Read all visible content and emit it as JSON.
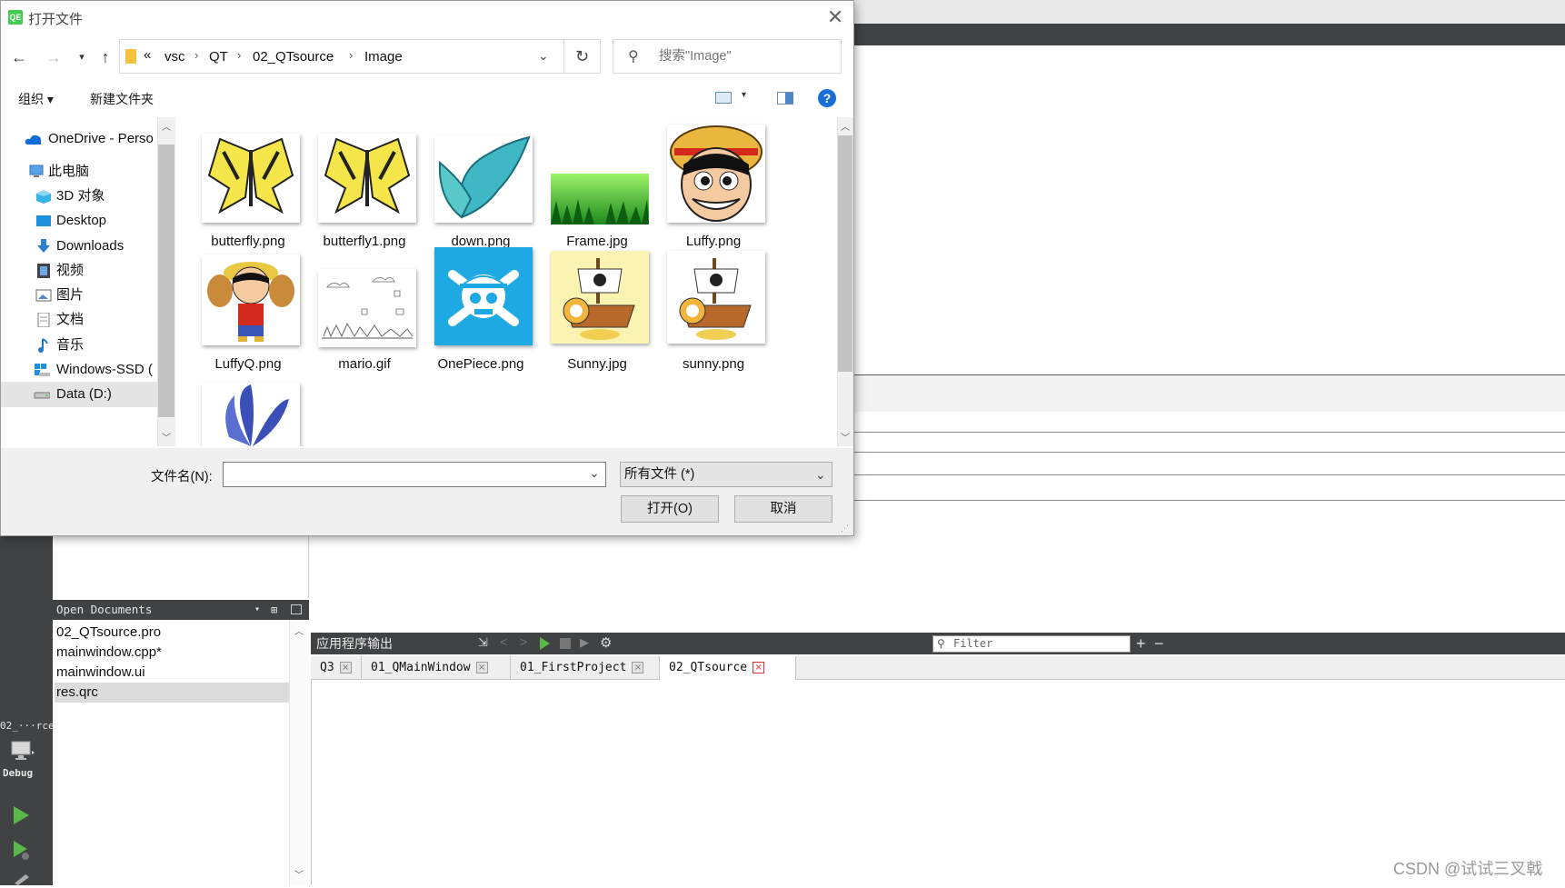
{
  "dialog": {
    "title": "打开文件",
    "app_icon_text": "QE",
    "path_overflow": "«",
    "breadcrumbs": [
      "vsc",
      "QT",
      "02_QTsource",
      "Image"
    ],
    "search_placeholder": "搜索\"Image\"",
    "toolbar": {
      "organize": "组织 ▾",
      "new_folder": "新建文件夹"
    },
    "nav_items": [
      {
        "label": "OneDrive - Perso",
        "icon": "onedrive-cloud-icon"
      },
      {
        "label": "此电脑",
        "icon": "computer-icon"
      },
      {
        "label": "3D 对象",
        "icon": "3d-objects-icon"
      },
      {
        "label": "Desktop",
        "icon": "desktop-icon"
      },
      {
        "label": "Downloads",
        "icon": "download-arrow-icon"
      },
      {
        "label": "视频",
        "icon": "video-film-icon"
      },
      {
        "label": "图片",
        "icon": "pictures-icon"
      },
      {
        "label": "文档",
        "icon": "documents-icon"
      },
      {
        "label": "音乐",
        "icon": "music-note-icon"
      },
      {
        "label": "Windows-SSD (",
        "icon": "windows-drive-icon"
      },
      {
        "label": "Data (D:)",
        "icon": "drive-icon"
      }
    ],
    "files": [
      {
        "name": "butterfly.png",
        "thumb": "yellow-butterfly"
      },
      {
        "name": "butterfly1.png",
        "thumb": "yellow-butterfly"
      },
      {
        "name": "down.png",
        "thumb": "blue-butterfly"
      },
      {
        "name": "Frame.jpg",
        "thumb": "green-forest"
      },
      {
        "name": "Luffy.png",
        "thumb": "luffy-face"
      },
      {
        "name": "LuffyQ.png",
        "thumb": "luffy-chibi"
      },
      {
        "name": "mario.gif",
        "thumb": "mario-sketch"
      },
      {
        "name": "OnePiece.png",
        "thumb": "jolly-roger"
      },
      {
        "name": "Sunny.jpg",
        "thumb": "sunny-ship"
      },
      {
        "name": "sunny.png",
        "thumb": "sunny-ship"
      },
      {
        "name": "",
        "thumb": "purple-butterfly"
      }
    ],
    "filename_label": "文件名(N):",
    "filename_value": "",
    "filetype_selected": "所有文件 (*)",
    "open_button": "打开(O)",
    "cancel_button": "取消"
  },
  "qt": {
    "mode_project_label": "02_···rce",
    "mode_debug_label": "Debug",
    "open_documents_title": "Open Documents",
    "open_documents": [
      "02_QTsource.pro",
      "mainwindow.cpp*",
      "mainwindow.ui",
      "res.qrc"
    ],
    "selected_document": "res.qrc",
    "output_title": "应用程序输出",
    "filter_placeholder": "Filter",
    "output_tabs": [
      "Q3",
      "01_QMainWindow",
      "01_FirstProject",
      "02_QTsource"
    ],
    "active_tab": "02_QTsource"
  },
  "watermark": "CSDN @试试三叉戟",
  "colors": {
    "accent_blue": "#0078d7",
    "qt_dark": "#404244",
    "run_green": "#5ab84a"
  }
}
